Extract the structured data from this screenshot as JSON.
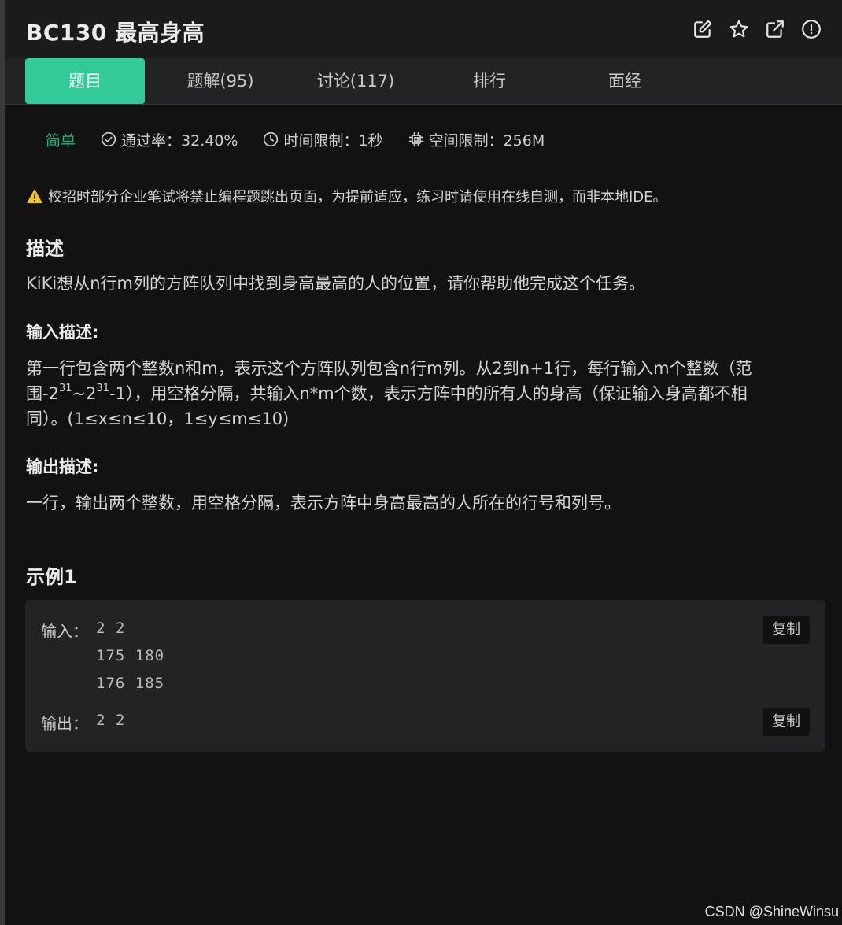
{
  "header": {
    "title": "BC130  最高身高",
    "icons": [
      "edit-icon",
      "star-icon",
      "external-link-icon",
      "alert-circle-icon"
    ]
  },
  "tabs": [
    {
      "label": "题目",
      "active": true
    },
    {
      "label": "题解(95)",
      "active": false
    },
    {
      "label": "讨论(117)",
      "active": false
    },
    {
      "label": "排行",
      "active": false
    },
    {
      "label": "面经",
      "active": false
    }
  ],
  "meta": {
    "difficulty": "简单",
    "pass_rate": "通过率：32.40%",
    "time_limit": "时间限制：1秒",
    "space_limit": "空间限制：256M"
  },
  "notice": "校招时部分企业笔试将禁止编程题跳出页面，为提前适应，练习时请使用在线自测，而非本地IDE。",
  "description": {
    "heading": "描述",
    "text": "KiKi想从n行m列的方阵队列中找到身高最高的人的位置，请你帮助他完成这个任务。"
  },
  "input_desc": {
    "heading": "输入描述:",
    "line1_a": "第一行包含两个整数n和m，表示这个方阵队列包含n行m列。从2到n+1行，每行输入m个整数（范",
    "line2_a": "围-2",
    "line2_sup1": "31",
    "line2_b": "~2",
    "line2_sup2": "31",
    "line2_c": "-1），用空格分隔，共输入n*m个数，表示方阵中的所有人的身高（保证输入身高都不相",
    "line3": "同）。(1≤x≤n≤10，1≤y≤m≤10)"
  },
  "output_desc": {
    "heading": "输出描述:",
    "text": "一行，输出两个整数，用空格分隔，表示方阵中身高最高的人所在的行号和列号。"
  },
  "example": {
    "heading": "示例1",
    "input_label": "输入：",
    "input_value": "2 2\n175 180\n176 185",
    "output_label": "输出：",
    "output_value": "2 2",
    "copy_label": "复制"
  },
  "watermark": "CSDN @ShineWinsu",
  "colors": {
    "accent": "#32ca99",
    "difficulty_easy": "#2fae84",
    "warning": "#f5c518"
  }
}
